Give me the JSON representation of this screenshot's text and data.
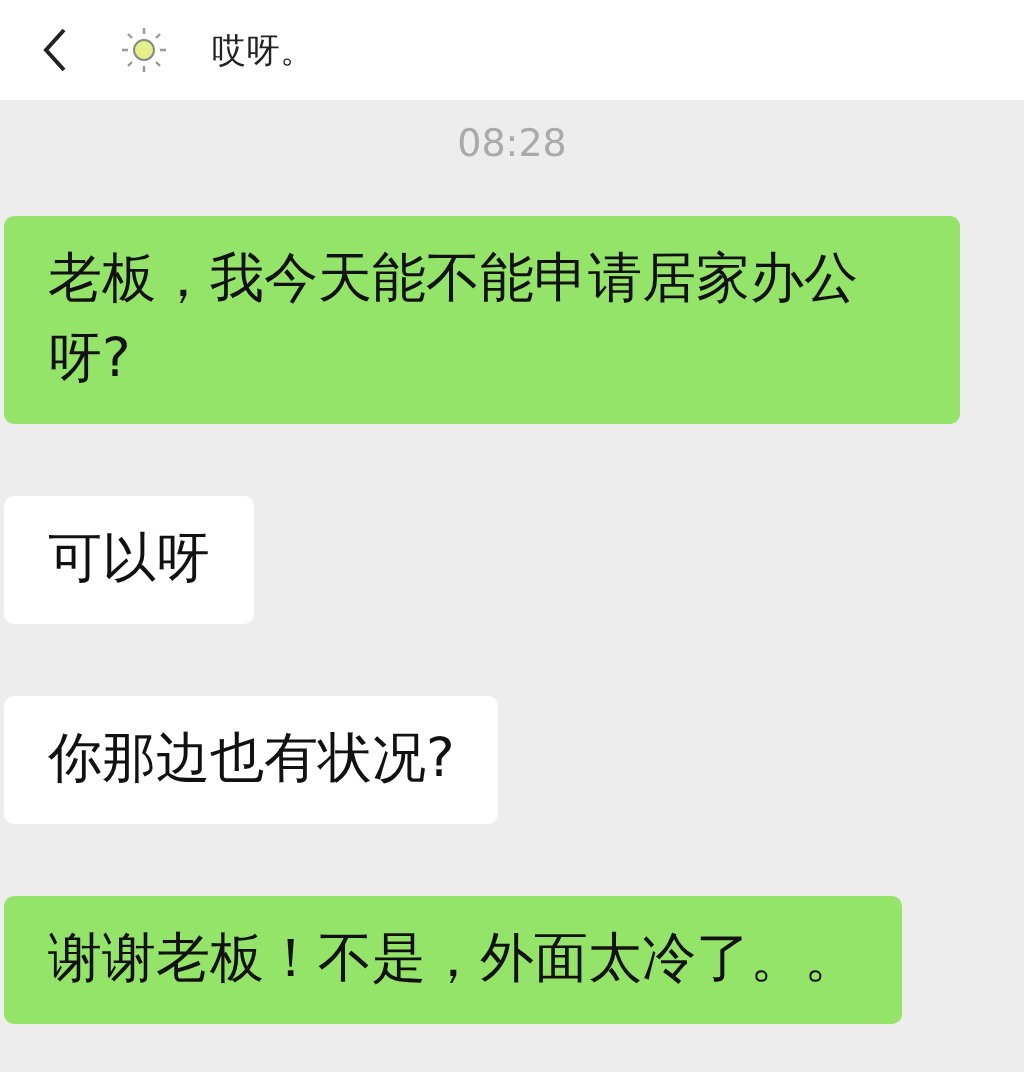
{
  "header": {
    "title": "哎呀。"
  },
  "time": "08:28",
  "messages": [
    {
      "kind": "self",
      "text": "老板，我今天能不能申请居家办公呀?"
    },
    {
      "kind": "other",
      "text": "可以呀"
    },
    {
      "kind": "other",
      "text": "你那边也有状况?"
    },
    {
      "kind": "self",
      "text": "谢谢老板！不是，外面太冷了。。"
    }
  ]
}
